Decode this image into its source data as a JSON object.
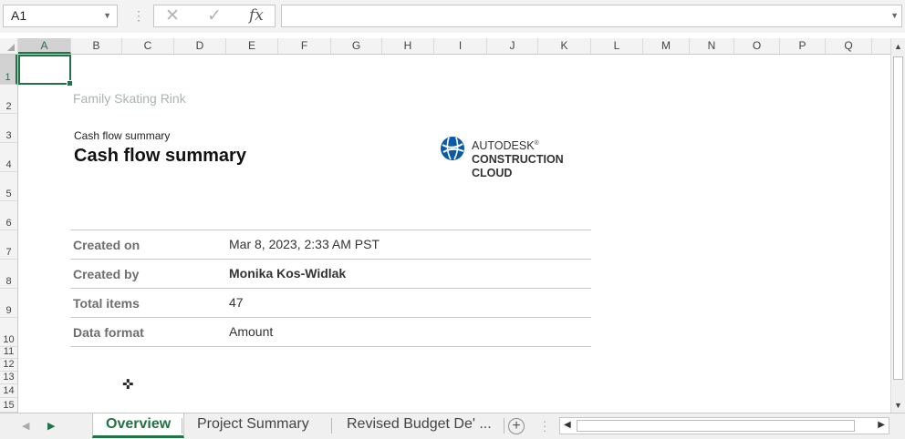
{
  "formula_bar": {
    "name_box": "A1",
    "cancel_symbol": "✕",
    "enter_symbol": "✓",
    "fx_label": "fx",
    "formula_value": ""
  },
  "columns": [
    "A",
    "B",
    "C",
    "D",
    "E",
    "F",
    "G",
    "H",
    "I",
    "J",
    "K",
    "L",
    "M",
    "N",
    "O",
    "P",
    "Q"
  ],
  "rows": [
    "1",
    "2",
    "3",
    "4",
    "5",
    "6",
    "7",
    "8",
    "9",
    "10",
    "11",
    "12",
    "13",
    "14",
    "15"
  ],
  "sheet": {
    "company": "Family Skating Rink",
    "subtitle": "Cash flow summary",
    "title": "Cash flow summary",
    "logo": {
      "line1": "AUTODESK",
      "trademark": "®",
      "line2": "CONSTRUCTION",
      "line3": "CLOUD",
      "accent_color": "#0a5aa8"
    },
    "details": [
      {
        "label": "Created on",
        "value": "Mar 8, 2023, 2:33 AM PST",
        "bold": false
      },
      {
        "label": "Created by",
        "value": "Monika Kos-Widlak",
        "bold": true
      },
      {
        "label": "Total items",
        "value": "47",
        "bold": false
      },
      {
        "label": "Data format",
        "value": "Amount",
        "bold": false
      }
    ]
  },
  "tabs": [
    {
      "label": "Overview",
      "active": true
    },
    {
      "label": "Project Summary",
      "active": false
    },
    {
      "label": "Revised Budget De' ...",
      "active": false
    }
  ],
  "colors": {
    "excel_green": "#217346"
  },
  "icons": {
    "name_box_dropdown": "chevron-down-icon",
    "cancel": "close-icon",
    "enter": "checkmark-icon",
    "add_sheet": "plus-circle-icon",
    "cursor": "cell-select-cross-icon"
  }
}
